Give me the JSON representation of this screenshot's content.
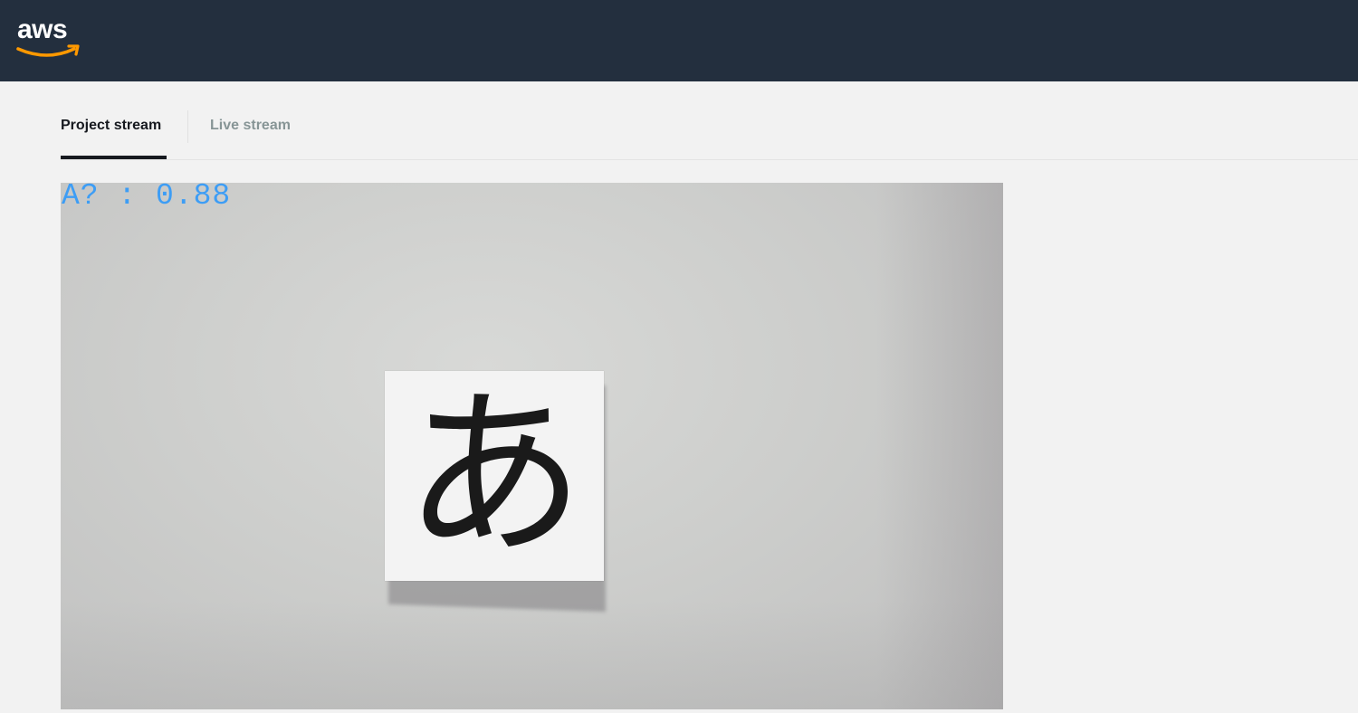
{
  "header": {
    "logo_text": "aws",
    "logo_color": "#ffffff",
    "smile_color": "#ff9900",
    "background": "#232f3e"
  },
  "tabs": [
    {
      "label": "Project stream",
      "active": true
    },
    {
      "label": "Live stream",
      "active": false
    }
  ],
  "stream": {
    "prediction_label": "A? : 0.88",
    "label_color": "#3d9df5",
    "paper_character": "あ"
  }
}
